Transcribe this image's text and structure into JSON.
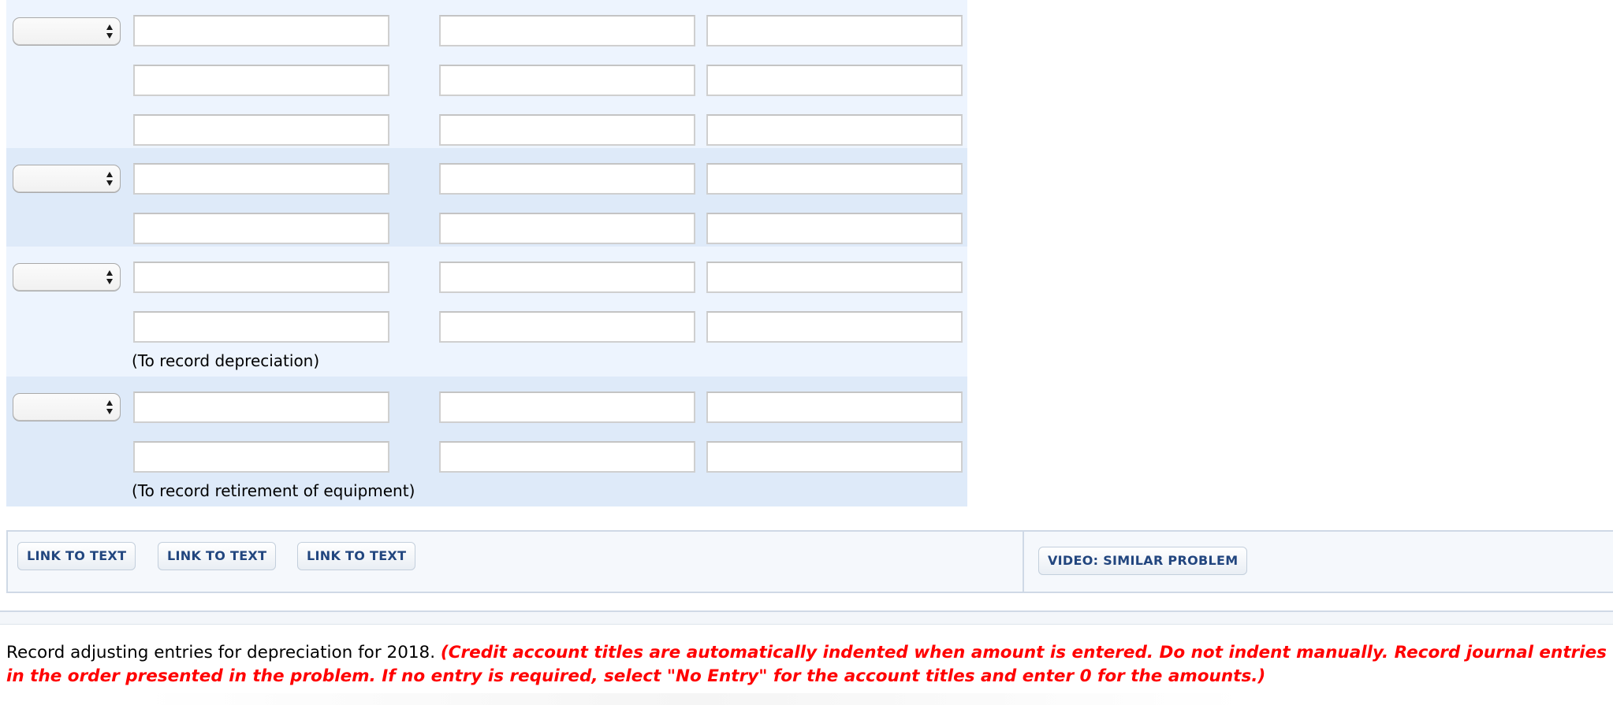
{
  "journal": {
    "entries": [
      {
        "account_select": "",
        "rows": [
          {
            "account": "",
            "debit": "",
            "credit": ""
          },
          {
            "account": "",
            "debit": "",
            "credit": ""
          },
          {
            "account": "",
            "debit": "",
            "credit": ""
          }
        ],
        "note": ""
      },
      {
        "account_select": "",
        "rows": [
          {
            "account": "",
            "debit": "",
            "credit": ""
          },
          {
            "account": "",
            "debit": "",
            "credit": ""
          }
        ],
        "note": ""
      },
      {
        "account_select": "",
        "rows": [
          {
            "account": "",
            "debit": "",
            "credit": ""
          },
          {
            "account": "",
            "debit": "",
            "credit": ""
          }
        ],
        "note": "(To record depreciation)"
      },
      {
        "account_select": "",
        "rows": [
          {
            "account": "",
            "debit": "",
            "credit": ""
          },
          {
            "account": "",
            "debit": "",
            "credit": ""
          }
        ],
        "note": "(To record retirement of equipment)"
      }
    ]
  },
  "resources": {
    "link_buttons": [
      "LINK TO TEXT",
      "LINK TO TEXT",
      "LINK TO TEXT"
    ],
    "video_button": "VIDEO: SIMILAR PROBLEM"
  },
  "instructions": {
    "main": "Record adjusting entries for depreciation for 2018. ",
    "emphasis": "(Credit account titles are automatically indented when amount is entered. Do not indent manually. Record journal entries in the order presented in the problem. If no entry is required, select \"No Entry\" for the account titles and enter 0 for the amounts.)"
  },
  "colors": {
    "band_light": "#edf4fe",
    "band_dark": "#deeaf9",
    "button_text": "#22467f",
    "instruction_emphasis": "#ff0000"
  }
}
